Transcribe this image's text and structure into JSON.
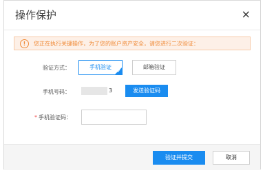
{
  "dialog": {
    "title": "操作保护",
    "close_icon": "close-icon",
    "close_glyph": "×"
  },
  "notice": {
    "icon": "warning-icon",
    "icon_glyph": "!",
    "text": "您正在执行关键操作，为了您的账户资产安全，请您进行二次验证："
  },
  "form": {
    "method_label": "验证方式：",
    "methods": [
      {
        "label": "手机验证",
        "selected": true
      },
      {
        "label": "邮箱验证",
        "selected": false
      }
    ],
    "phone_label": "手机号码：",
    "phone_visible_tail": "3",
    "send_code_label": "发送验证码",
    "code_required_mark": "*",
    "code_label": "手机验证码：",
    "code_value": "",
    "code_placeholder": ""
  },
  "footer": {
    "submit_label": "验证并提交",
    "cancel_label": "取消"
  },
  "colors": {
    "primary": "#1a8cf0",
    "warning": "#f08b39",
    "warning_bg": "#fdf0e7",
    "required": "#f04b4b"
  }
}
